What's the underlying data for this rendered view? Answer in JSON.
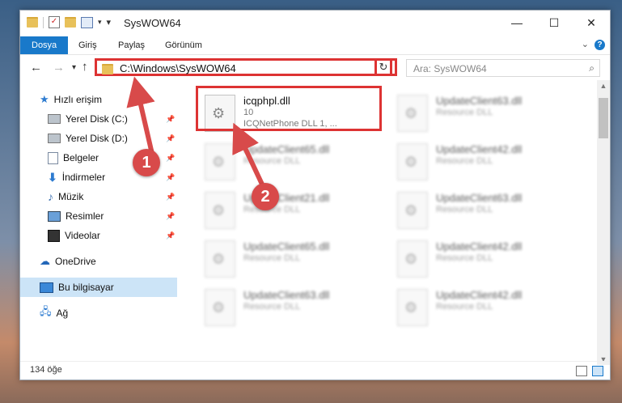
{
  "window": {
    "title": "SysWOW64",
    "controls": {
      "minimize": "—",
      "maximize": "☐",
      "close": "✕"
    }
  },
  "ribbon": {
    "tabs": [
      "Dosya",
      "Giriş",
      "Paylaş",
      "Görünüm"
    ],
    "help": "?"
  },
  "navigation": {
    "back": "←",
    "forward": "→",
    "recent": "▾",
    "up": "↑",
    "address": "C:\\Windows\\SysWOW64",
    "address_dropdown": "⌄",
    "refresh": "↻",
    "search_placeholder": "Ara: SysWOW64",
    "search_icon": "magnifier-icon"
  },
  "sidebar": {
    "items": [
      {
        "label": "Hızlı erişim",
        "icon": "star-icon"
      },
      {
        "label": "Yerel Disk (C:)",
        "icon": "drive-icon"
      },
      {
        "label": "Yerel Disk (D:)",
        "icon": "drive-icon"
      },
      {
        "label": "Belgeler",
        "icon": "documents-icon"
      },
      {
        "label": "İndirmeler",
        "icon": "download-icon"
      },
      {
        "label": "Müzik",
        "icon": "music-icon"
      },
      {
        "label": "Resimler",
        "icon": "pictures-icon"
      },
      {
        "label": "Videolar",
        "icon": "video-icon"
      },
      {
        "label": "OneDrive",
        "icon": "cloud-icon"
      },
      {
        "label": "Bu bilgisayar",
        "icon": "computer-icon"
      },
      {
        "label": "Ağ",
        "icon": "network-icon"
      }
    ],
    "selected": "Bu bilgisayar"
  },
  "files": [
    {
      "name": "icqphpl.dll",
      "line2": "10",
      "line3": "ICQNetPhone DLL 1, ..."
    },
    {
      "name": "UpdateClient63.dll",
      "line2": "Resource DLL"
    },
    {
      "name": "UpdateClient65.dll",
      "line2": "Resource DLL"
    },
    {
      "name": "UpdateClient42.dll",
      "line2": "Resource DLL"
    },
    {
      "name": "UpdateClient21.dll",
      "line2": "Resource DLL"
    },
    {
      "name": "UpdateClient63.dll",
      "line2": "Resource DLL"
    },
    {
      "name": "UpdateClient65.dll",
      "line2": "Resource DLL"
    },
    {
      "name": "UpdateClient42.dll",
      "line2": "Resource DLL"
    },
    {
      "name": "UpdateClient63.dll",
      "line2": "Resource DLL"
    },
    {
      "name": "UpdateClient42.dll",
      "line2": "Resource DLL"
    }
  ],
  "status": {
    "count": "134 öğe"
  },
  "annotations": {
    "step1": "1",
    "step2": "2"
  },
  "colors": {
    "accent": "#1979ca",
    "highlight": "#d33333"
  }
}
